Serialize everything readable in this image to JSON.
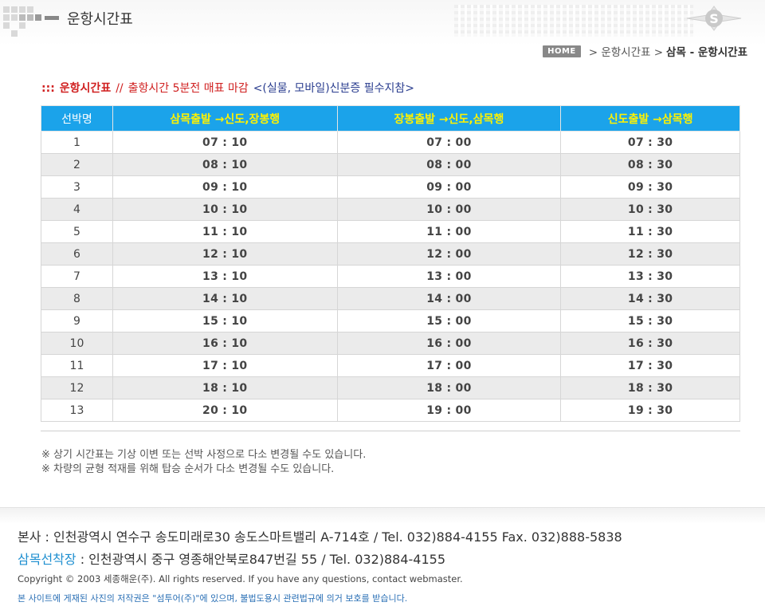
{
  "header": {
    "page_title": "운항시간표",
    "logo_letter": "S",
    "breadcrumb": {
      "home": "HOME",
      "level1": "> 운항시간표 >",
      "current": "삼목 - 운항시간표"
    }
  },
  "notice": {
    "marker": ":::",
    "label": "운항시간표",
    "separator": "//",
    "text": "출항시간 5분전 매표 마감",
    "id_note": "<(실물, 모바일)신분증 필수지참>"
  },
  "table": {
    "headers": {
      "vessel": "선박명",
      "route1": "삼목출발 →신도,장봉행",
      "route2": "장봉출발 →신도,삼목행",
      "route3": "신도출발 →삼목행"
    },
    "rows": [
      {
        "no": "1",
        "t1": "07 : 10",
        "t2": "07 : 00",
        "t3": "07 : 30"
      },
      {
        "no": "2",
        "t1": "08 : 10",
        "t2": "08 : 00",
        "t3": "08 : 30"
      },
      {
        "no": "3",
        "t1": "09 : 10",
        "t2": "09 : 00",
        "t3": "09 : 30"
      },
      {
        "no": "4",
        "t1": "10 : 10",
        "t2": "10 : 00",
        "t3": "10 : 30"
      },
      {
        "no": "5",
        "t1": "11 : 10",
        "t2": "11 : 00",
        "t3": "11 : 30"
      },
      {
        "no": "6",
        "t1": "12 : 10",
        "t2": "12 : 00",
        "t3": "12 : 30"
      },
      {
        "no": "7",
        "t1": "13 : 10",
        "t2": "13 : 00",
        "t3": "13 : 30"
      },
      {
        "no": "8",
        "t1": "14 : 10",
        "t2": "14 : 00",
        "t3": "14 : 30"
      },
      {
        "no": "9",
        "t1": "15 : 10",
        "t2": "15 : 00",
        "t3": "15 : 30"
      },
      {
        "no": "10",
        "t1": "16 : 10",
        "t2": "16 : 00",
        "t3": "16 : 30"
      },
      {
        "no": "11",
        "t1": "17 : 10",
        "t2": "17 : 00",
        "t3": "17 : 30"
      },
      {
        "no": "12",
        "t1": "18 : 10",
        "t2": "18 : 00",
        "t3": "18 : 30"
      },
      {
        "no": "13",
        "t1": "20 : 10",
        "t2": "19 : 00",
        "t3": "19 : 30"
      }
    ]
  },
  "notes": [
    "※ 상기 시간표는 기상 이변 또는 선박 사정으로 다소 변경될 수도 있습니다.",
    "※ 차량의 균형 적재를 위해 탑승 순서가 다소 변경될 수도 있습니다."
  ],
  "footer": {
    "hq": "본사 : 인천광역시 연수구 송도미래로30 송도스마트밸리 A-714호 / Tel. 032)884-4155  Fax. 032)888-5838",
    "branch_label": "삼목선착장",
    "branch_text": " : 인천광역시 중구 영종해안북로847번길 55  /  Tel. 032)884-4155",
    "copyright": "Copyright © 2003 세종해운(주).  All rights reserved. If you have any questions, contact webmaster.",
    "photo_notice": "본 사이트에 게재된 사진의 저작권은 \"섬투어(주)\"에 있으며, 불법도용시 관련법규에 의거 보호를 받습니다."
  },
  "colors": {
    "header_blue": "#1ba3ea",
    "route_yellow": "#fff200",
    "notice_red": "#d02020",
    "notice_navy": "#2a3d8f"
  }
}
